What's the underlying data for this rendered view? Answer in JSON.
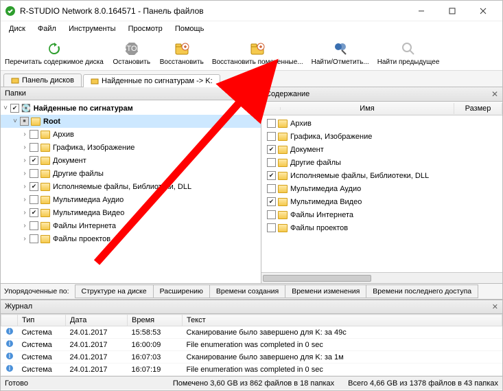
{
  "window": {
    "title": "R-STUDIO Network 8.0.164571 - Панель файлов"
  },
  "menu": [
    "Диск",
    "Файл",
    "Инструменты",
    "Просмотр",
    "Помощь"
  ],
  "toolbar": [
    {
      "label": "Перечитать содержимое диска",
      "icon": "refresh",
      "color": "#2e9e2e"
    },
    {
      "label": "Остановить",
      "icon": "stop",
      "color": "#999"
    },
    {
      "label": "Восстановить",
      "icon": "recover",
      "color": "#d06030"
    },
    {
      "label": "Восстановить помеченные...",
      "icon": "recover-marked",
      "color": "#d06030"
    },
    {
      "label": "Найти/Отметить...",
      "icon": "find",
      "color": "#3a6fb0"
    },
    {
      "label": "Найти предыдущее",
      "icon": "find-prev",
      "color": "#bbb"
    }
  ],
  "tabs": [
    {
      "label": "Панель дисков",
      "active": false
    },
    {
      "label": "Найденные по сигнатурам -> K:",
      "active": true
    }
  ],
  "leftPane": {
    "header": "Папки",
    "tree": {
      "rootParent": {
        "label": "Найденные по сигнатурам",
        "check": "chk"
      },
      "root": {
        "label": "Root",
        "check": "mix",
        "highlight": true
      },
      "items": [
        {
          "label": "Архив",
          "check": ""
        },
        {
          "label": "Графика, Изображение",
          "check": ""
        },
        {
          "label": "Документ",
          "check": "chk"
        },
        {
          "label": "Другие файлы",
          "check": ""
        },
        {
          "label": "Исполняемые файлы, Библиотеки, DLL",
          "check": "chk"
        },
        {
          "label": "Мультимедиа Аудио",
          "check": ""
        },
        {
          "label": "Мультимедиа Видео",
          "check": "chk"
        },
        {
          "label": "Файлы Интернета",
          "check": ""
        },
        {
          "label": "Файлы проектов",
          "check": ""
        }
      ]
    }
  },
  "rightPane": {
    "header": "Содержание",
    "cols": {
      "name": "Имя",
      "size": "Размер"
    },
    "items": [
      {
        "label": "Архив",
        "check": ""
      },
      {
        "label": "Графика, Изображение",
        "check": ""
      },
      {
        "label": "Документ",
        "check": "chk"
      },
      {
        "label": "Другие файлы",
        "check": ""
      },
      {
        "label": "Исполняемые файлы, Библиотеки, DLL",
        "check": "chk"
      },
      {
        "label": "Мультимедиа Аудио",
        "check": ""
      },
      {
        "label": "Мультимедиа Видео",
        "check": "chk"
      },
      {
        "label": "Файлы Интернета",
        "check": ""
      },
      {
        "label": "Файлы проектов",
        "check": ""
      }
    ]
  },
  "sort": {
    "label": "Упорядоченные по:",
    "buttons": [
      "Структуре на диске",
      "Расширению",
      "Времени создания",
      "Времени изменения",
      "Времени последнего доступа"
    ]
  },
  "log": {
    "header": "Журнал",
    "cols": [
      "Тип",
      "Дата",
      "Время",
      "Текст"
    ],
    "rows": [
      {
        "type": "Система",
        "date": "24.01.2017",
        "time": "15:58:53",
        "text": "Сканирование было завершено для K: за 49с"
      },
      {
        "type": "Система",
        "date": "24.01.2017",
        "time": "16:00:09",
        "text": "File enumeration was completed in 0 sec"
      },
      {
        "type": "Система",
        "date": "24.01.2017",
        "time": "16:07:03",
        "text": "Сканирование было завершено для K: за 1м"
      },
      {
        "type": "Система",
        "date": "24.01.2017",
        "time": "16:07:19",
        "text": "File enumeration was completed in 0 sec"
      }
    ]
  },
  "status": {
    "left": "Готово",
    "mid": "Помечено 3,60 GB из 862 файлов в 18 папках",
    "right": "Всего 4,66 GB из 1378 файлов в 43 папках"
  }
}
